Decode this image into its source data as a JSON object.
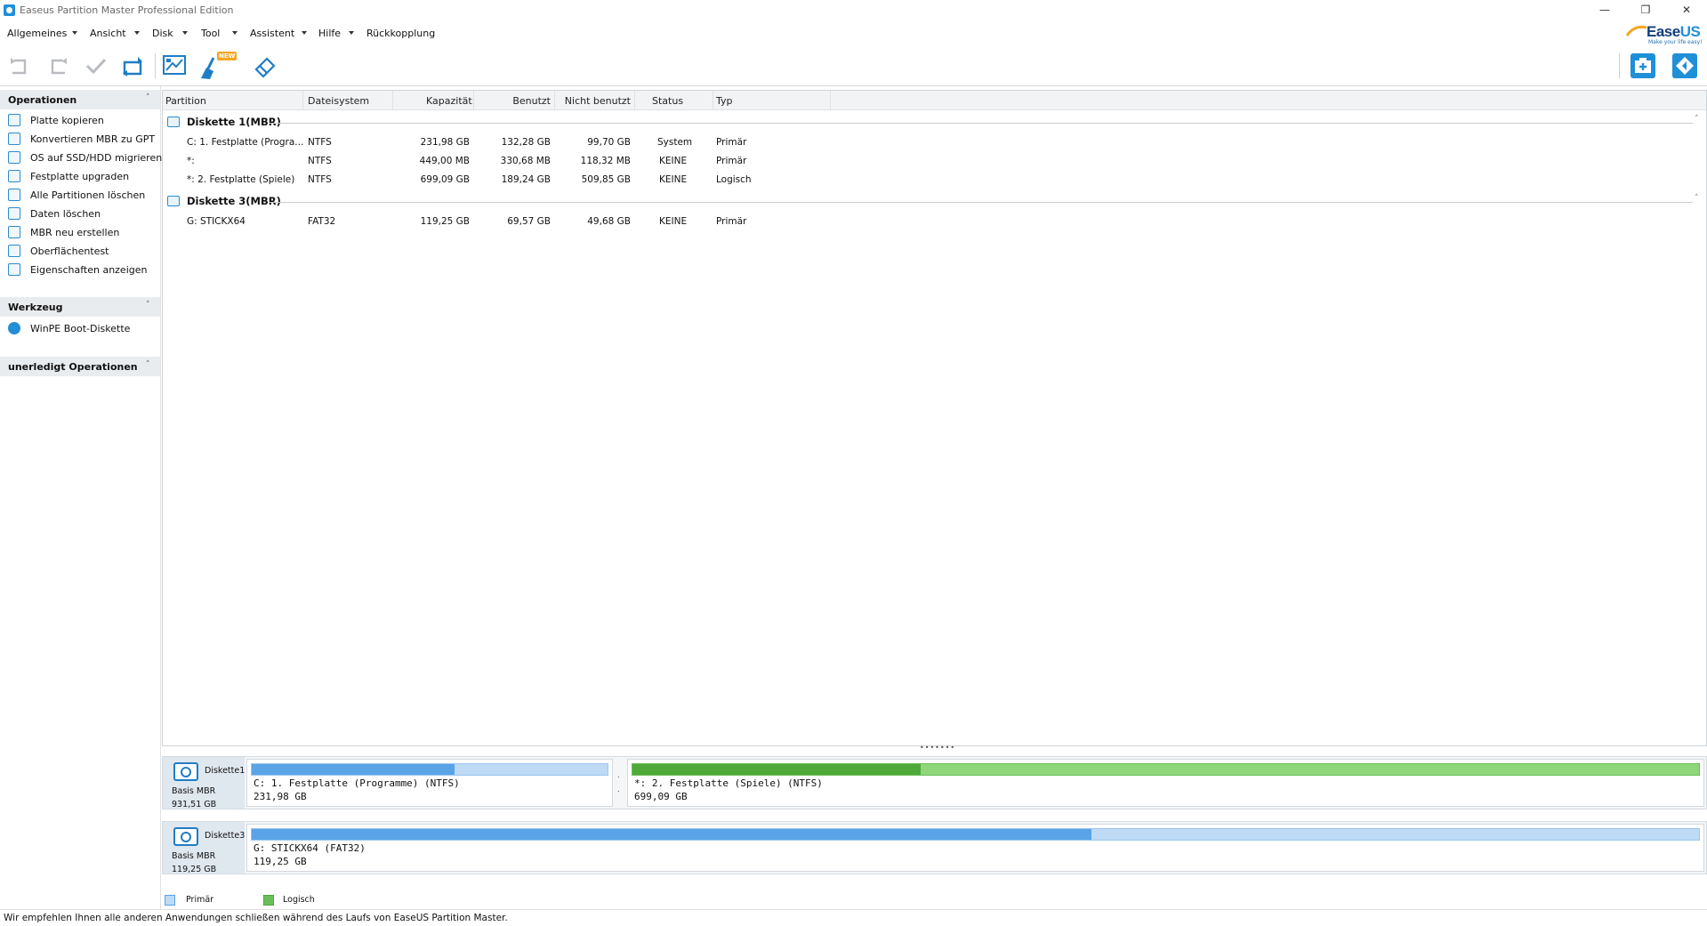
{
  "window": {
    "title": "Easeus Partition Master Professional Edition"
  },
  "menu": [
    "Allgemeines",
    "Ansicht",
    "Disk",
    "Tool",
    "Assistent",
    "Hilfe",
    "Rückkopplung"
  ],
  "logo": {
    "brand_a": "Ease",
    "brand_b": "US",
    "tagline": "Make your life easy!"
  },
  "toolbar": {
    "new_badge": "NEW"
  },
  "sidebar": {
    "operations_title": "Operationen",
    "operations": [
      "Platte kopieren",
      "Konvertieren MBR zu GPT",
      "OS auf SSD/HDD migrieren",
      "Festplatte upgraden",
      "Alle Partitionen löschen",
      "Daten löschen",
      "MBR neu erstellen",
      "Oberflächentest",
      "Eigenschaften anzeigen"
    ],
    "tools_title": "Werkzeug",
    "tools": [
      "WinPE Boot-Diskette"
    ],
    "pending_title": "unerledigt Operationen"
  },
  "table": {
    "columns": [
      "Partition",
      "Dateisystem",
      "Kapazität:",
      "Benutzt",
      "Nicht benutzt",
      "Status",
      "Typ"
    ],
    "disks": [
      {
        "label": "Diskette 1(MBR)",
        "rows": [
          [
            "C: 1. Festplatte (Progra...",
            "NTFS",
            "231,98 GB",
            "132,28 GB",
            "99,70 GB",
            "System",
            "Primär"
          ],
          [
            "*:",
            "NTFS",
            "449,00 MB",
            "330,68 MB",
            "118,32 MB",
            "KEINE",
            "Primär"
          ],
          [
            "*: 2. Festplatte (Spiele)",
            "NTFS",
            "699,09 GB",
            "189,24 GB",
            "509,85 GB",
            "KEINE",
            "Logisch"
          ]
        ]
      },
      {
        "label": "Diskette 3(MBR)",
        "rows": [
          [
            "G: STICKX64",
            "FAT32",
            "119,25 GB",
            "69,57 GB",
            "49,68 GB",
            "KEINE",
            "Primär"
          ]
        ]
      }
    ]
  },
  "diskmap": [
    {
      "name": "Diskette1",
      "type": "Basis MBR",
      "size": "931,51 GB",
      "partitions": [
        {
          "label": "C: 1. Festplatte (Programme) (NTFS)",
          "size": "231,98 GB",
          "used_fraction": 0.57,
          "kind": "primary"
        },
        {
          "label": "*: 2. Festplatte (Spiele) (NTFS)",
          "size": "699,09 GB",
          "used_fraction": 0.27,
          "kind": "logical"
        }
      ]
    },
    {
      "name": "Diskette3",
      "type": "Basis MBR",
      "size": "119,25 GB",
      "partitions": [
        {
          "label": "G: STICKX64 (FAT32)",
          "size": "119,25 GB",
          "used_fraction": 0.58,
          "kind": "primary"
        }
      ]
    }
  ],
  "legend": {
    "primary": "Primär",
    "logical": "Logisch"
  },
  "status": "Wir empfehlen Ihnen alle anderen Anwendungen schließen während des Laufs von EaseUS Partition Master.",
  "colors": {
    "accent": "#1f8fd8",
    "primary_used": "#5aa3e6",
    "logical_used": "#4ea83a"
  }
}
